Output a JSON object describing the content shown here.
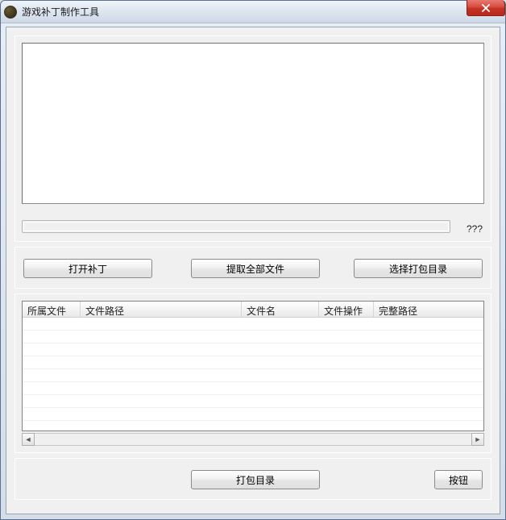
{
  "window": {
    "title": "游戏补丁制作工具"
  },
  "progress": {
    "label": "???"
  },
  "buttons": {
    "open_patch": "打开补丁",
    "extract_all": "提取全部文件",
    "select_pack_dir": "选择打包目录",
    "pack_dir": "打包目录",
    "button": "按钮"
  },
  "table": {
    "columns": {
      "owner_file": "所属文件",
      "file_path": "文件路径",
      "file_name": "文件名",
      "file_op": "文件操作",
      "full_path": "完整路径"
    },
    "rows": []
  },
  "textarea": {
    "value": ""
  }
}
